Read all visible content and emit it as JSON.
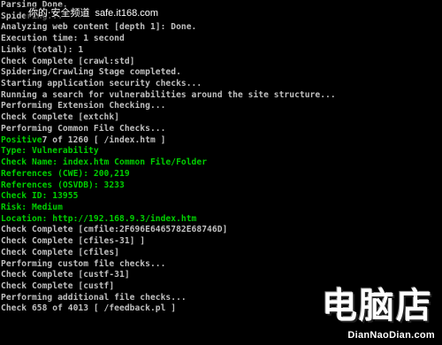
{
  "terminal": {
    "lines": [
      {
        "text": "Parsing Done.",
        "color": "gray"
      },
      {
        "text": "Spidering...",
        "color": "gray"
      },
      {
        "text": "Analyzing web content [depth 1]: Done.",
        "color": "gray"
      },
      {
        "text": "Execution time: 1 second",
        "color": "gray"
      },
      {
        "text": "Links (total): 1",
        "color": "gray"
      },
      {
        "text": "Check Complete [crawl:std]",
        "color": "gray"
      },
      {
        "text": "Spidering/Crawling Stage completed.",
        "color": "gray"
      },
      {
        "text": "Starting application security checks...",
        "color": "gray"
      },
      {
        "text": "Running a search for vulnerabilities around the site structure...",
        "color": "gray"
      },
      {
        "text": "Performing Extension Checking...",
        "color": "gray"
      },
      {
        "text": "Check Complete [extchk]",
        "color": "gray"
      },
      {
        "text": "Performing Common File Checks...",
        "color": "gray"
      },
      {
        "segments": [
          {
            "text": "Positive",
            "color": "green"
          },
          {
            "text": "7 of 1260 [ /index.htm ]",
            "color": "gray"
          }
        ]
      },
      {
        "text": "Type: Vulnerability",
        "color": "green"
      },
      {
        "text": "Check Name: index.htm Common File/Folder",
        "color": "green"
      },
      {
        "text": "References (CWE): 200,219",
        "color": "green"
      },
      {
        "text": "References (OSVDB): 3233",
        "color": "green"
      },
      {
        "text": "Check ID: 13955",
        "color": "green"
      },
      {
        "text": "Risk: Medium",
        "color": "green"
      },
      {
        "text": "Location: http://192.168.9.3/index.htm",
        "color": "green"
      },
      {
        "text": "Check Complete [cmfile:2F696E6465782E68746D]",
        "color": "gray"
      },
      {
        "text": "Check Complete [cfiles-31] ]",
        "color": "gray"
      },
      {
        "text": "Check Complete [cfiles]",
        "color": "gray"
      },
      {
        "text": "Performing custom file checks...",
        "color": "gray"
      },
      {
        "text": "Check Complete [custf-31]",
        "color": "gray"
      },
      {
        "text": "Check Complete [custf]",
        "color": "gray"
      },
      {
        "text": "Performing additional file checks...",
        "color": "gray"
      },
      {
        "text": "Check 658 of 4013 [ /feedback.pl ]",
        "color": "gray"
      }
    ]
  },
  "colors": {
    "background": "#000000",
    "text_gray": "#c0c0c0",
    "text_green": "#00d000"
  },
  "watermark_top": {
    "label": "你的·安全频道",
    "url": "safe.it168.com"
  },
  "watermark_logo": {
    "title": "电脑店",
    "domain": "DianNaoDian.com"
  }
}
